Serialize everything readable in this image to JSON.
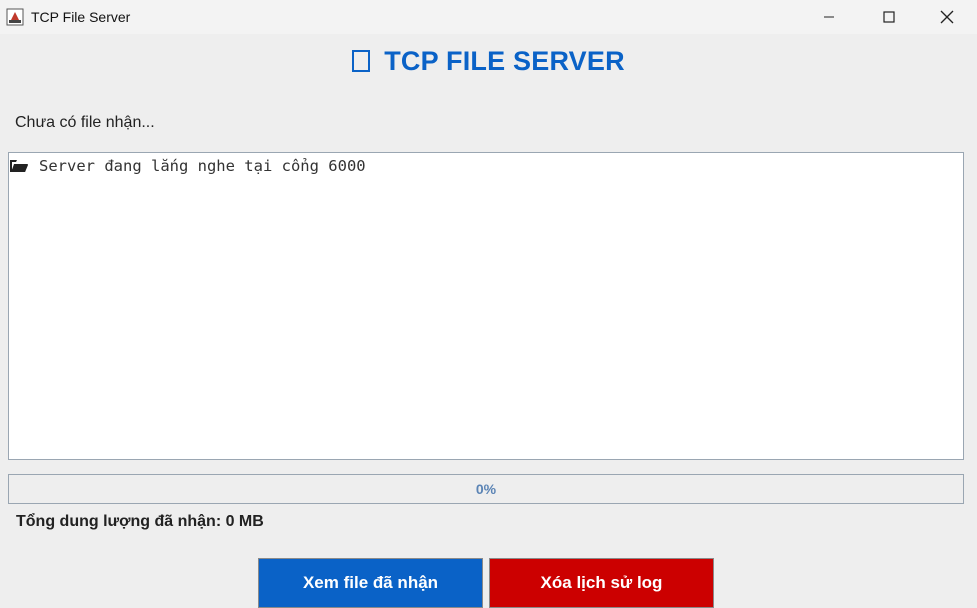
{
  "window": {
    "title": "TCP File Server",
    "minimize_glyph": "—",
    "maximize_glyph": "☐",
    "close_glyph": "✕"
  },
  "header": {
    "title": "TCP FILE SERVER"
  },
  "status": {
    "text": "Chưa có file nhận..."
  },
  "log": {
    "lines": [
      {
        "icon": "open-folder-icon",
        "text": "Server đang lắng nghe tại cổng 6000"
      }
    ]
  },
  "progress": {
    "value": 0,
    "label": "0%"
  },
  "summary": {
    "total_received": "Tổng dung lượng đã nhận: 0 MB"
  },
  "buttons": {
    "view_files": "Xem file đã nhận",
    "clear_log": "Xóa lịch sử log"
  },
  "colors": {
    "accent": "#0a62c7",
    "danger": "#cc0000",
    "background": "#eeeeee"
  }
}
